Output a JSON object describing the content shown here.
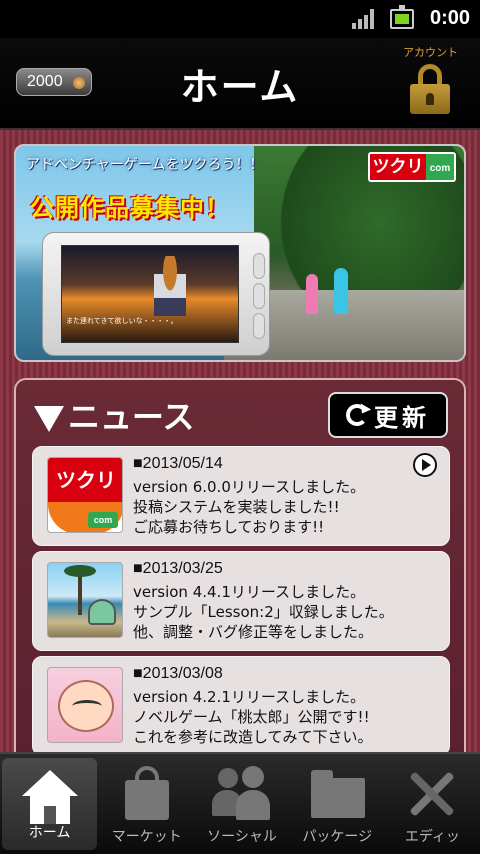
{
  "status_bar": {
    "time": "0:00"
  },
  "header": {
    "coins": "2000",
    "title": "ホーム",
    "account_label": "アカウント"
  },
  "banner": {
    "headline": "アドベンチャーゲームをツクろう！！",
    "subtitle": "公開作品募集中！",
    "logo_text": "ツクリ",
    "logo_suffix": "com",
    "phone_caption": "また連れてきて欲しいな・・・・。"
  },
  "news": {
    "title": "ニュース",
    "refresh_label": "更新",
    "items": [
      {
        "date": "■2013/05/14",
        "body": "version 6.0.0リリースしました。\n投稿システムを実装しました!!\nご応募お待ちしております!!",
        "thumb": "tsukuri-logo"
      },
      {
        "date": "■2013/03/25",
        "body": "version 4.4.1リリースしました。\nサンプル「Lesson:2」収録しました。\n他、調整・バグ修正等をしました。",
        "thumb": "beach-photo"
      },
      {
        "date": "■2013/03/08",
        "body": "version 4.2.1リリースしました。\nノベルゲーム「桃太郎」公開です!!\nこれを参考に改造してみて下さい。",
        "thumb": "baby-illustration"
      }
    ]
  },
  "tabs": [
    {
      "label": "ホーム",
      "icon": "home-icon",
      "active": true
    },
    {
      "label": "マーケット",
      "icon": "bag-icon",
      "active": false
    },
    {
      "label": "ソーシャル",
      "icon": "people-icon",
      "active": false
    },
    {
      "label": "パッケージ",
      "icon": "folder-icon",
      "active": false
    },
    {
      "label": "エディッ",
      "icon": "tools-icon",
      "active": false
    }
  ],
  "colors": {
    "background_stripe": "#8c3a49",
    "accent_gold": "#d9a13a",
    "banner_yellow": "#ffe600",
    "logo_red": "#d8000f"
  }
}
